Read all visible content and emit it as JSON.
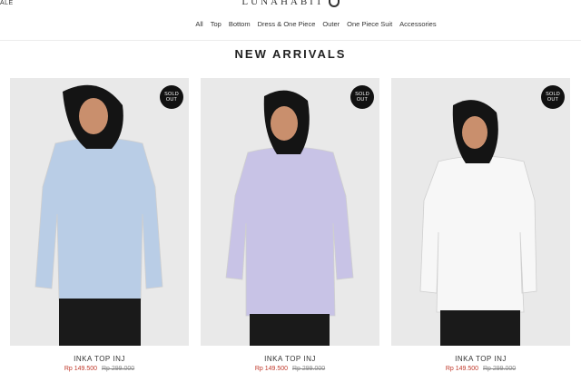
{
  "header": {
    "sale_label": "ALE",
    "brand": "LUNAHABIT"
  },
  "nav": {
    "items": [
      {
        "label": "All"
      },
      {
        "label": "Top"
      },
      {
        "label": "Bottom"
      },
      {
        "label": "Dress & One Piece"
      },
      {
        "label": "Outer"
      },
      {
        "label": "One Piece Suit"
      },
      {
        "label": "Accessories"
      }
    ]
  },
  "section": {
    "title": "NEW ARRIVALS"
  },
  "products": [
    {
      "name": "INKA TOP INJ",
      "price": "Rp 149.500",
      "original_price": "Rp 299.000",
      "badge": "SOLD OUT",
      "shirt_color": "#b9cde6"
    },
    {
      "name": "INKA TOP INJ",
      "price": "Rp 149.500",
      "original_price": "Rp 299.000",
      "badge": "SOLD OUT",
      "shirt_color": "#c8c3e6"
    },
    {
      "name": "INKA TOP INJ",
      "price": "Rp 149.500",
      "original_price": "Rp 299.000",
      "badge": "SOLD OUT",
      "shirt_color": "#f7f7f7"
    }
  ]
}
